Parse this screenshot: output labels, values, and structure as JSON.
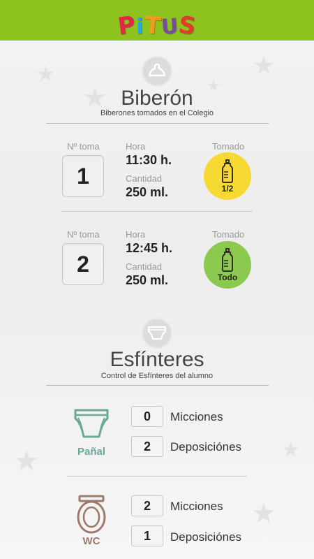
{
  "app": {
    "logo_letters": [
      "P",
      "i",
      "T",
      "U",
      "S"
    ],
    "brand_color": "#8cc31f"
  },
  "bottle": {
    "icon": "bottle-nipple-icon",
    "title": "Biberón",
    "subtitle": "Biberones tomados en el Colegio",
    "col_num": "Nº toma",
    "col_time": "Hora",
    "col_qty": "Cantidad",
    "col_taken": "Tomado",
    "rows": [
      {
        "number": "1",
        "time": "11:30 h.",
        "quantity": "250 ml.",
        "taken": "1/2",
        "taken_color": "#f6d932"
      },
      {
        "number": "2",
        "time": "12:45 h.",
        "quantity": "250 ml.",
        "taken": "Todo",
        "taken_color": "#8cc94f"
      }
    ]
  },
  "sphincters": {
    "icon": "diaper-icon",
    "title": "Esfínteres",
    "subtitle": "Control de Esfínteres del alumno",
    "diaper": {
      "label": "Pañal",
      "color": "#6aa89a",
      "urinations_count": "0",
      "urinations_label": "Micciones",
      "depositions_count": "2",
      "depositions_label": "Deposiciónes"
    },
    "wc": {
      "label": "WC",
      "color": "#9c7b6b",
      "urinations_count": "2",
      "urinations_label": "Micciones",
      "depositions_count": "1",
      "depositions_label": "Deposiciónes"
    }
  }
}
